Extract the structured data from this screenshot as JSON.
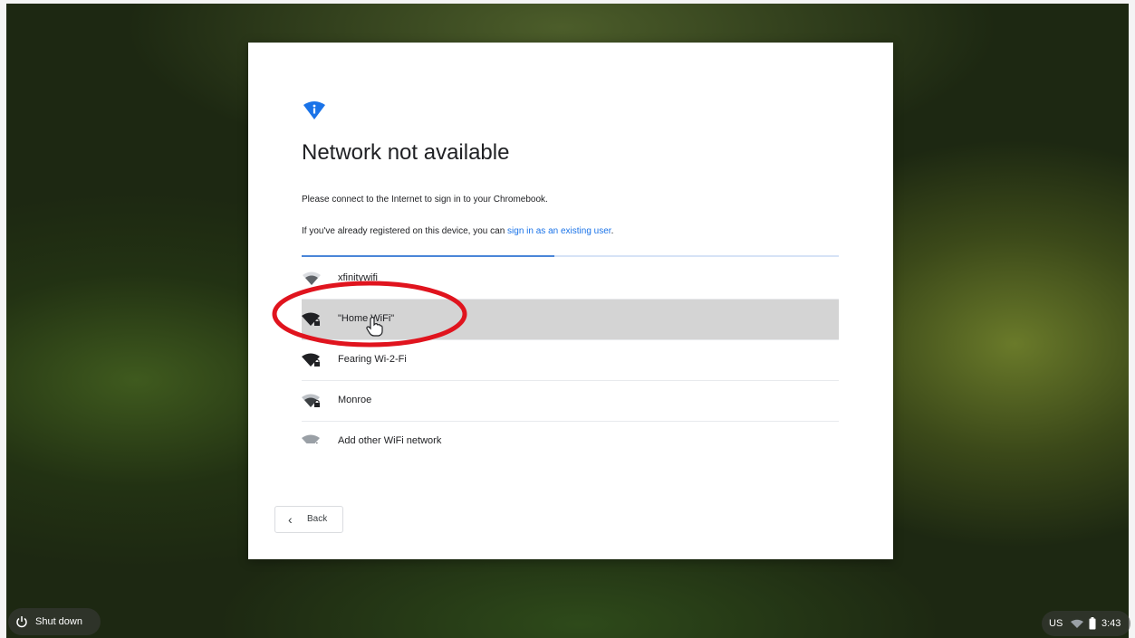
{
  "dialog": {
    "title": "Network not available",
    "subtitle": "Please connect to the Internet to sign in to your Chromebook.",
    "existing_prefix": "If you've already registered on this device, you can ",
    "existing_link": "sign in as an existing user",
    "existing_suffix": ".",
    "progress_fraction": 0.47,
    "networks": [
      {
        "name": "xfinitywifi",
        "locked": false,
        "icon": "wifi-icon",
        "selected": false
      },
      {
        "name": "\"Home WiFi\"",
        "locked": true,
        "icon": "wifi-locked-icon",
        "selected": true
      },
      {
        "name": "Fearing Wi-2-Fi",
        "locked": true,
        "icon": "wifi-locked-icon",
        "selected": false
      },
      {
        "name": "Monroe",
        "locked": true,
        "icon": "wifi-locked-icon",
        "selected": false
      },
      {
        "name": "Add other WiFi network",
        "locked": false,
        "icon": "wifi-add-icon",
        "selected": false
      }
    ],
    "back_label": "Back"
  },
  "shelf": {
    "shutdown_label": "Shut down",
    "language": "US",
    "time": "3:43"
  },
  "colors": {
    "accent": "#1a73e8",
    "annotation": "#e0141e",
    "selected_row": "#d4d4d4"
  }
}
